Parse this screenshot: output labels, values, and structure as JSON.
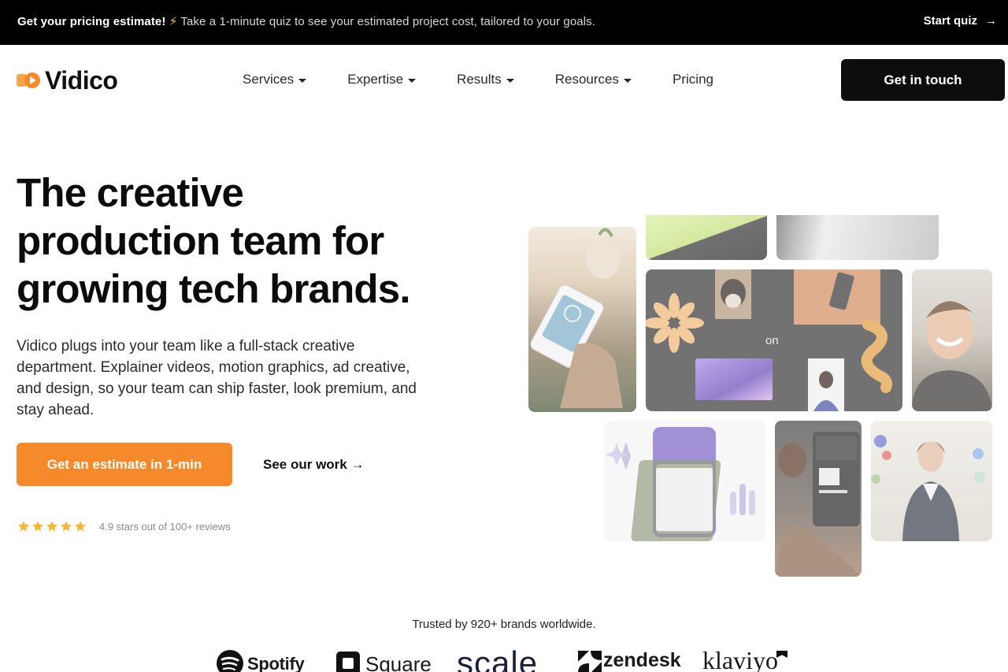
{
  "announcement": {
    "lead": "Get your pricing estimate!",
    "bolt": "⚡",
    "text": "Take a 1-minute quiz to see your estimated project cost, tailored to your goals.",
    "cta": "Start quiz",
    "cta_icon": "→"
  },
  "brand": {
    "name": "Vidico",
    "accent": "#f6892a"
  },
  "nav": {
    "items": [
      {
        "label": "Services",
        "dropdown": true
      },
      {
        "label": "Expertise",
        "dropdown": true
      },
      {
        "label": "Results",
        "dropdown": true
      },
      {
        "label": "Resources",
        "dropdown": true
      },
      {
        "label": "Pricing",
        "dropdown": false
      }
    ],
    "cta": "Get in touch"
  },
  "hero": {
    "title_lines": [
      "The creative",
      "production team for",
      "growing tech brands."
    ],
    "copy_lines": [
      "Vidico plugs into your team like a full-stack creative",
      "department. Explainer videos, motion graphics, ad creative,",
      "and design, so your team can ship faster, look premium, and",
      "stay ahead."
    ],
    "primary_cta": "Get an estimate in 1-min",
    "secondary_cta": "See our work →",
    "stars": 5,
    "rating_text": "4.9 stars out of 100+ reviews"
  },
  "collage": {
    "center_label": "on"
  },
  "trusted": {
    "label": "Trusted by 920+ brands worldwide.",
    "logos": [
      "Spotify",
      "Square",
      "scale",
      "zendesk",
      "klaviyo"
    ]
  }
}
